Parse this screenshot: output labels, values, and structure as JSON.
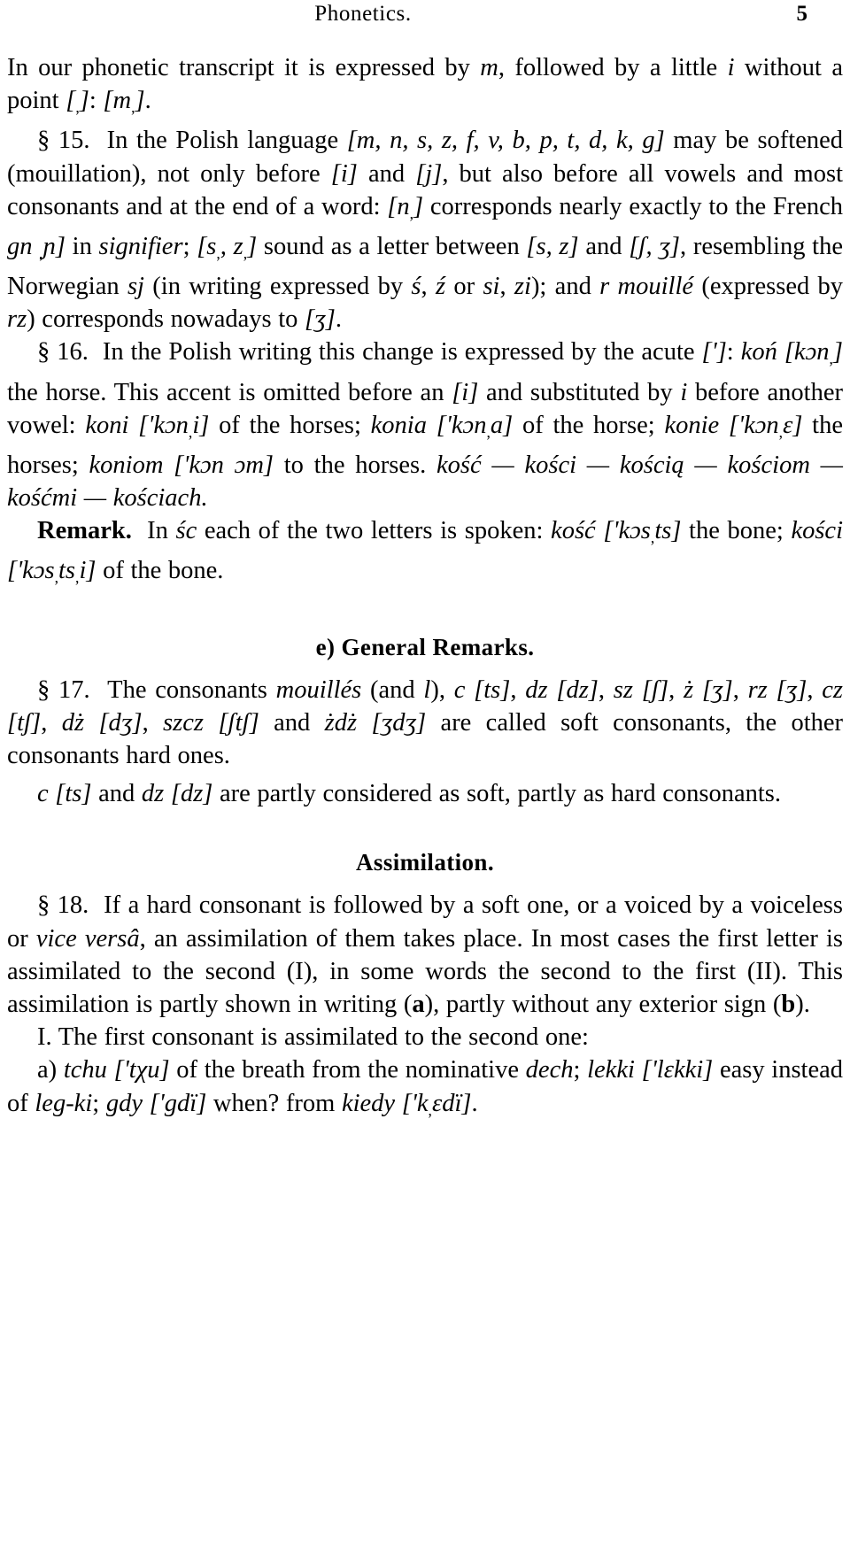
{
  "running_head": {
    "title": "Phonetics.",
    "folio": "5"
  },
  "body": {
    "para_continued": "In our phonetic transcript it is expressed by m, followed by a little i without a point [,]: [m,].",
    "section_15": {
      "marker": "§ 15.",
      "text": "In the Polish language [m, n, s, z, f, v, b, p, t, d, k, g] may be softened (mouillation), not only before [i] and [j], but also before all vowels and most consonants and at the end of a word: [n,] corresponds nearly exactly to the French gn [ɲ] in signifier; [s,, z,] sound as a letter between [s, z] and [ʃ, ʒ], resembling the Norwegian sj (in writing expressed by ś, ź or si, zi); and r mouillé (expressed by rz) corresponds nowadays to [ʒ]."
    },
    "section_16": {
      "marker": "§ 16.",
      "text": "In the Polish writing this change is expressed by the acute [']: koń [kɔn,] the horse. This accent is omitted before an [i] and substituted by i before another vowel: koni ['kɔn,i] of the horses; konia ['kɔn,a] of the horse; konie ['kɔn,ɛ] the horses; koniom ['kɔn ɔm] to the horses. kość — kości — kością — kościom — kośćmi — kościach."
    },
    "remark": {
      "label": "Remark.",
      "text": "In śc each of the two letters is spoken: kość ['kɔsts] the bone; kości ['kɔsts,i] of the bone."
    },
    "heading_general_remarks": "e) General Remarks.",
    "section_17": {
      "marker": "§ 17.",
      "text": "The consonants mouillés (and l), c [ts], dz [dz], sz [ʃ], ż [ʒ], rz [ʒ], cz [tʃ], dż [dʒ], szcz [ʃtʃ] and żdż [ʒdʒ] are called soft consonants, the other consonants hard ones."
    },
    "para_c_dz": "c [ts] and dz [dz] are partly considered as soft, partly as hard consonants.",
    "heading_assimilation": "Assimilation.",
    "section_18": {
      "marker": "§ 18.",
      "text": "If a hard consonant is followed by a soft one, or a voiced by a voiceless or vice versâ, an assimilation of them takes place. In most cases the first letter is assimilated to the second (I), in some words the second to the first (II). This assimilation is partly shown in writing (a), partly without any exterior sign (b)."
    },
    "rule_I": {
      "marker": "I.",
      "text": "The first consonant is assimilated to the second one:"
    },
    "rule_I_a": {
      "marker": "a)",
      "text": "tchu ['tχu] of the breath from the nominative dech; lekki ['lɛkki] easy instead of leg-ki; gdy ['gdï] when? from kiedy ['k,ɛdï]."
    }
  }
}
